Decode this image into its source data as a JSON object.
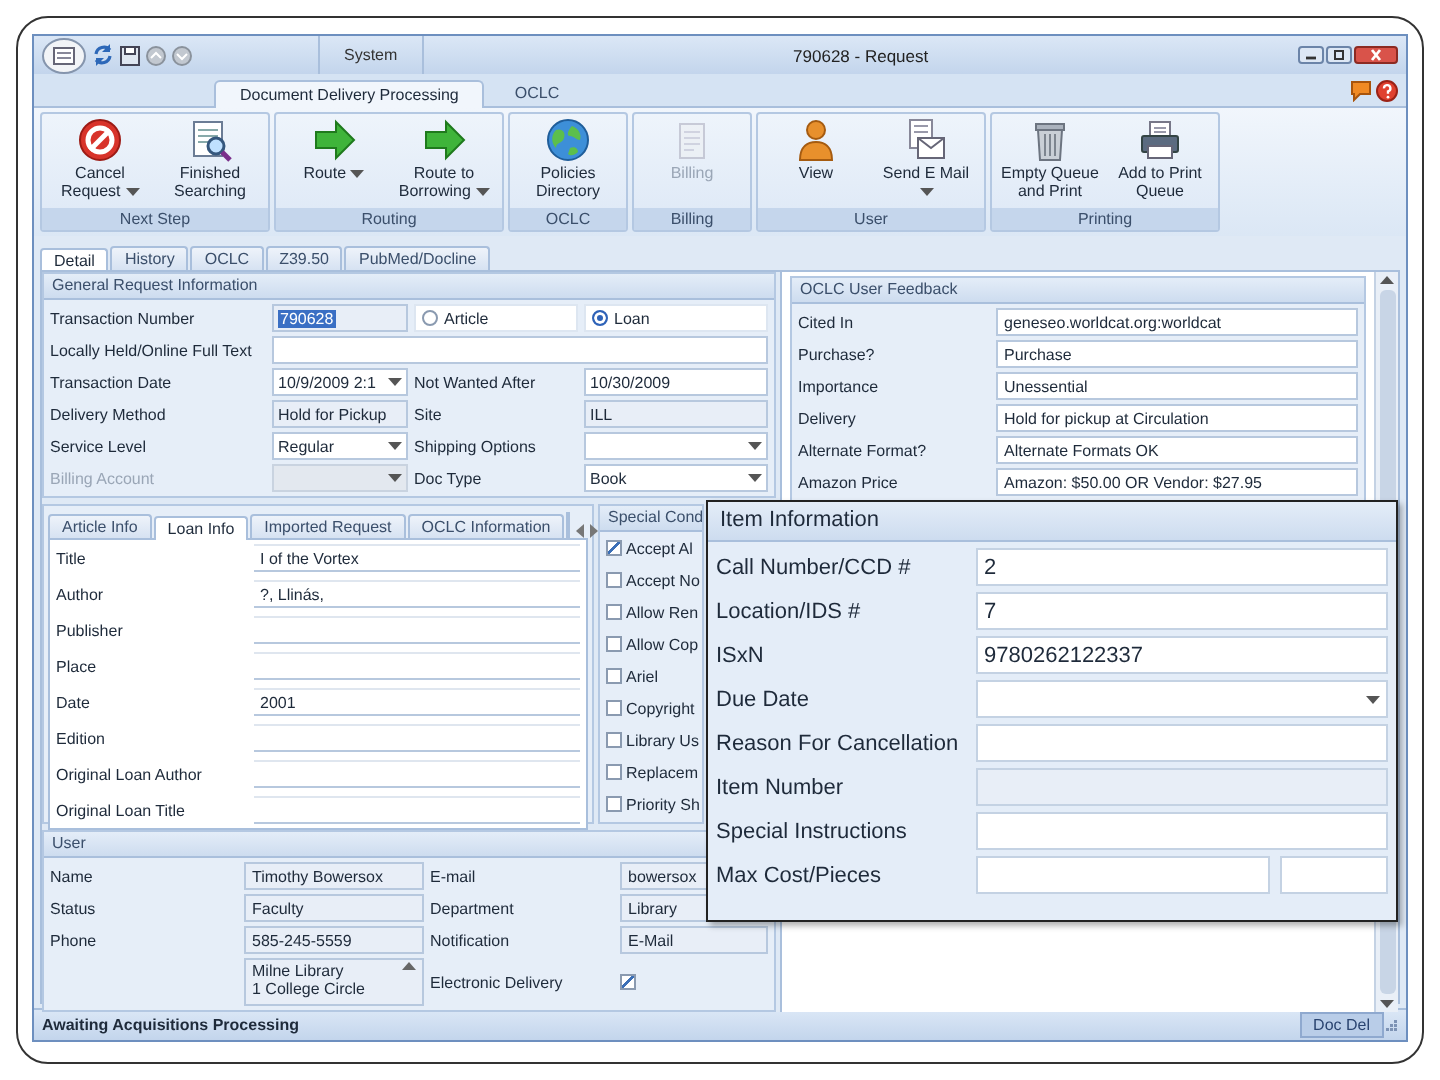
{
  "window": {
    "title": "790628 - Request",
    "system_tab": "System"
  },
  "ribbon_tabs": [
    {
      "label": "Document Delivery Processing",
      "selected": true
    },
    {
      "label": "OCLC",
      "selected": false
    }
  ],
  "ribbon_groups": [
    {
      "label": "Next Step",
      "buttons": [
        {
          "label": "Cancel Request",
          "dropdown": true,
          "disabled": false
        },
        {
          "label": "Finished Searching",
          "dropdown": false,
          "disabled": false
        }
      ]
    },
    {
      "label": "Routing",
      "buttons": [
        {
          "label": "Route",
          "dropdown": true,
          "disabled": false
        },
        {
          "label": "Route to Borrowing",
          "dropdown": true,
          "disabled": false
        }
      ]
    },
    {
      "label": "OCLC",
      "buttons": [
        {
          "label": "Policies Directory",
          "dropdown": false,
          "disabled": false
        }
      ]
    },
    {
      "label": "Billing",
      "buttons": [
        {
          "label": "Billing",
          "dropdown": false,
          "disabled": true
        }
      ]
    },
    {
      "label": "User",
      "buttons": [
        {
          "label": "View",
          "dropdown": false,
          "disabled": false
        },
        {
          "label": "Send E Mail",
          "dropdown": true,
          "disabled": false
        }
      ]
    },
    {
      "label": "Printing",
      "buttons": [
        {
          "label": "Empty Queue and Print",
          "dropdown": false,
          "disabled": false
        },
        {
          "label": "Add to Print Queue",
          "dropdown": false,
          "disabled": false
        }
      ]
    }
  ],
  "detail_tabs": [
    {
      "label": "Detail",
      "selected": true
    },
    {
      "label": "History",
      "selected": false
    },
    {
      "label": "OCLC",
      "selected": false
    },
    {
      "label": "Z39.50",
      "selected": false
    },
    {
      "label": "PubMed/Docline",
      "selected": false
    }
  ],
  "general": {
    "title": "General Request Information",
    "rows": [
      [
        {
          "label": "Transaction Number",
          "value": "790628",
          "kind": "selected"
        },
        {
          "kind": "radio",
          "options": [
            {
              "label": "Article",
              "selected": false
            },
            {
              "label": "Loan",
              "selected": true
            }
          ]
        }
      ],
      [
        {
          "label": "Locally Held/Online Full Text",
          "kind": "wide"
        }
      ],
      [
        {
          "label": "Transaction Date",
          "value": "10/9/2009 2:1",
          "kind": "dropdown"
        },
        {
          "label": "Not Wanted After",
          "value": "10/30/2009",
          "kind": "text"
        }
      ],
      [
        {
          "label": "Delivery Method",
          "value": "Hold for Pickup",
          "kind": "readonly"
        },
        {
          "label": "Site",
          "value": "ILL",
          "kind": "readonly"
        }
      ],
      [
        {
          "label": "Service Level",
          "value": "Regular",
          "kind": "dropdown"
        },
        {
          "label": "Shipping Options",
          "kind": "dropdown"
        }
      ],
      [
        {
          "label": "Billing Account",
          "kind": "dropdown",
          "disabled": true
        },
        {
          "label": "Doc Type",
          "value": "Book",
          "kind": "dropdown"
        }
      ]
    ]
  },
  "feedback": {
    "title": "OCLC User Feedback",
    "rows": [
      {
        "label": "Cited In",
        "value": "geneseo.worldcat.org:worldcat"
      },
      {
        "label": "Purchase?",
        "value": "Purchase"
      },
      {
        "label": "Importance",
        "value": "Unessential"
      },
      {
        "label": "Delivery",
        "value": "Hold for pickup at Circulation"
      },
      {
        "label": "Alternate Format?",
        "value": "Alternate Formats OK"
      },
      {
        "label": "Amazon Price",
        "value": "Amazon: $50.00 OR Vendor: $27.95"
      }
    ]
  },
  "loan_tabs": [
    {
      "label": "Article Info",
      "selected": false
    },
    {
      "label": "Loan Info",
      "selected": true
    },
    {
      "label": "Imported Request",
      "selected": false
    },
    {
      "label": "OCLC Information",
      "selected": false
    }
  ],
  "loan_fields": [
    {
      "label": "Title",
      "value": "I of the Vortex"
    },
    {
      "label": "Author",
      "value": "?, Llinás,"
    },
    {
      "label": "Publisher"
    },
    {
      "label": "Place"
    },
    {
      "label": "Date",
      "value": "2001"
    },
    {
      "label": "Edition"
    },
    {
      "label": "Original Loan Author"
    },
    {
      "label": "Original Loan Title"
    }
  ],
  "special_conditions": {
    "title": "Special Cond",
    "items": [
      {
        "label": "Accept Al",
        "checked": true
      },
      {
        "label": "Accept No",
        "checked": false
      },
      {
        "label": "Allow Ren",
        "checked": false
      },
      {
        "label": "Allow Cop",
        "checked": false
      },
      {
        "label": "Ariel",
        "checked": false
      },
      {
        "label": "Copyright",
        "checked": false
      },
      {
        "label": "Library Us",
        "checked": false
      },
      {
        "label": "Replacem",
        "checked": false
      },
      {
        "label": "Priority Sh",
        "checked": false
      }
    ]
  },
  "item_information": {
    "title": "Item Information",
    "fields": [
      {
        "label": "Call Number/CCD #",
        "value": "2",
        "kind": "text"
      },
      {
        "label": "Location/IDS #",
        "value": "7",
        "kind": "text"
      },
      {
        "label": "ISxN",
        "value": "9780262122337",
        "kind": "text"
      },
      {
        "label": "Due Date",
        "kind": "dropdown"
      },
      {
        "label": "Reason For Cancellation",
        "kind": "text"
      },
      {
        "label": "Item Number",
        "kind": "readonly"
      },
      {
        "label": "Special Instructions",
        "kind": "text"
      },
      {
        "label": "Max Cost/Pieces",
        "kind": "pair"
      }
    ]
  },
  "user": {
    "title": "User",
    "rows": [
      [
        {
          "label": "Name",
          "value": "Timothy Bowersox",
          "kind": "readonly"
        },
        {
          "label": "E-mail",
          "value": "bowersox",
          "kind": "readonly"
        }
      ],
      [
        {
          "label": "Status",
          "value": "Faculty",
          "kind": "readonly"
        },
        {
          "label": "Department",
          "value": "Library",
          "kind": "readonly"
        }
      ],
      [
        {
          "label": "Phone",
          "value": "585-245-5559",
          "kind": "readonly"
        },
        {
          "label": "Notification",
          "value": "E-Mail",
          "kind": "readonly"
        }
      ],
      [
        {
          "kind": "address",
          "lines": [
            "Milne Library",
            "1 College Circle"
          ]
        },
        {
          "label": "Electronic Delivery",
          "kind": "checkbox",
          "checked": true
        }
      ]
    ]
  },
  "status_bar": {
    "status": "Awaiting Acquisitions Processing",
    "queue": "Doc Del"
  }
}
